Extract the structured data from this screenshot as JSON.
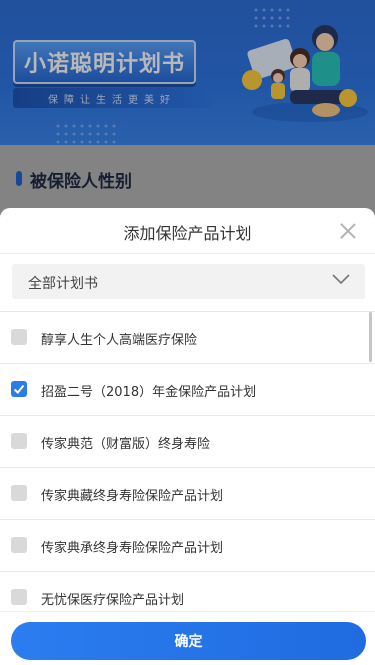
{
  "banner": {
    "title": "小诺聪明计划书",
    "subtitle": "保障让生活更美好"
  },
  "gender_section": {
    "title": "被保险人性别"
  },
  "sheet": {
    "title": "添加保险产品计划",
    "select": {
      "value": "全部计划书"
    },
    "items": [
      {
        "label": "醇享人生个人高端医疗保险",
        "checked": false
      },
      {
        "label": "招盈二号（2018）年金保险产品计划",
        "checked": true
      },
      {
        "label": "传家典范（财富版）终身寿险",
        "checked": false
      },
      {
        "label": "传家典藏终身寿险保险产品计划",
        "checked": false
      },
      {
        "label": "传家典承终身寿险保险产品计划",
        "checked": false
      },
      {
        "label": "无忧保医疗保险产品计划",
        "checked": false
      }
    ],
    "confirm_label": "确定"
  },
  "colors": {
    "accent": "#2a7ce6",
    "checkbox_unchecked": "#d9d9d9",
    "banner_blue": "#2e78e6"
  }
}
